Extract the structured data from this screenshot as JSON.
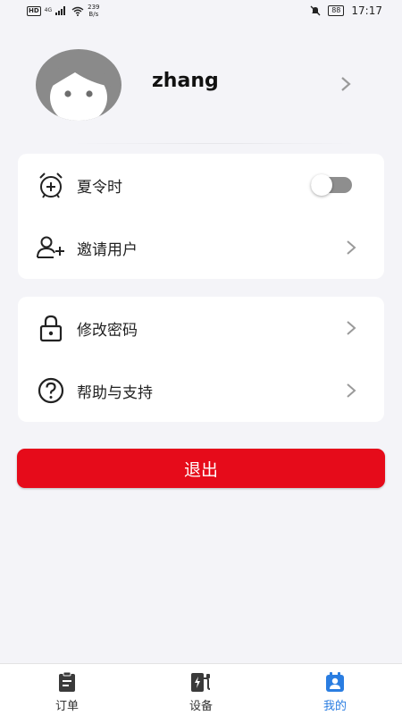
{
  "status_bar": {
    "hd": "HD",
    "network": "4G",
    "speed_value": "239",
    "speed_unit": "B/s",
    "battery": "88",
    "time": "17:17"
  },
  "profile": {
    "name": "zhang"
  },
  "settings_group_1": [
    {
      "label": "夏令时",
      "icon": "alarm-plus-icon",
      "control": "toggle",
      "toggle_on": false
    },
    {
      "label": "邀请用户",
      "icon": "add-user-icon",
      "control": "chevron"
    }
  ],
  "settings_group_2": [
    {
      "label": "修改密码",
      "icon": "lock-icon",
      "control": "chevron"
    },
    {
      "label": "帮助与支持",
      "icon": "help-icon",
      "control": "chevron"
    }
  ],
  "logout": {
    "label": "退出",
    "color": "#e60b1a"
  },
  "bottom_nav": [
    {
      "label": "订单",
      "icon": "clipboard-icon",
      "active": false
    },
    {
      "label": "设备",
      "icon": "charger-icon",
      "active": false
    },
    {
      "label": "我的",
      "icon": "profile-icon",
      "active": true
    }
  ],
  "colors": {
    "accent": "#2a7de1",
    "background": "#f4f4f8",
    "toggle_off": "#8e8e8e"
  }
}
